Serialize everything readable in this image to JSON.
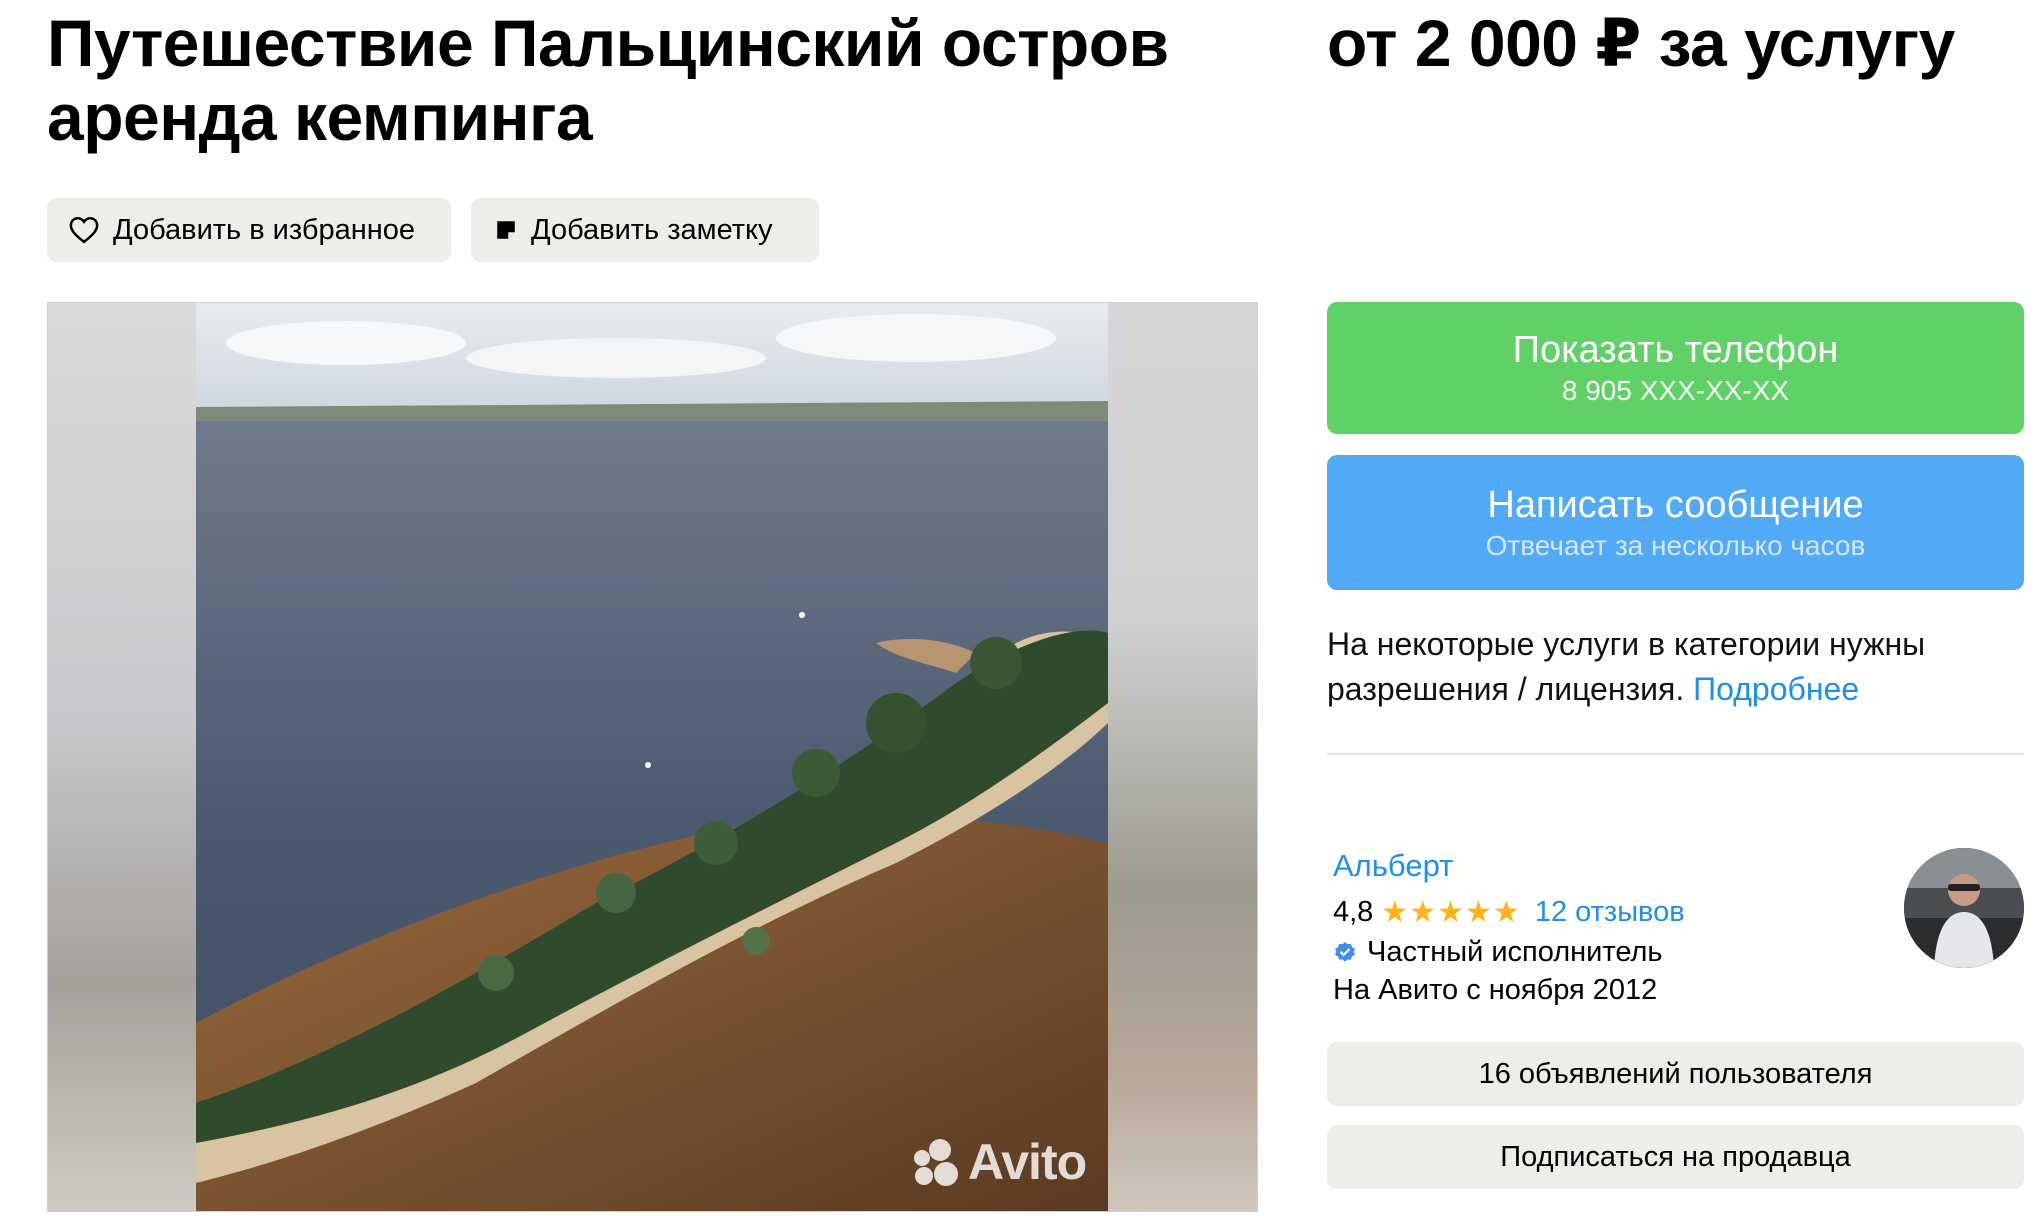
{
  "listing": {
    "title": "Путешествие Пальцинский остров аренда кемпинга",
    "price": "от 2 000 ₽ за услугу"
  },
  "actions": {
    "favorite_label": "Добавить в избранное",
    "note_label": "Добавить заметку"
  },
  "gallery": {
    "watermark": "Avito"
  },
  "contact": {
    "phone_label": "Показать телефон",
    "phone_masked": "8 905 XXX-XX-XX",
    "message_label": "Написать сообщение",
    "message_sub": "Отвечает за несколько часов"
  },
  "notice": {
    "text": "На некоторые услуги в категории нужны разрешения / лицензия.",
    "link": "Подробнее"
  },
  "seller": {
    "name": "Альберт",
    "rating": "4,8",
    "stars": "★★★★★",
    "reviews": "12 отзывов",
    "type": "Частный исполнитель",
    "since": "На Авито с ноября 2012",
    "ads_label": "16 объявлений пользователя",
    "subscribe_label": "Подписаться на продавца"
  },
  "colors": {
    "phone_button": "#60d167",
    "message_button": "#52a9f6",
    "link": "#1e8ff0",
    "star": "#ffb21a"
  }
}
